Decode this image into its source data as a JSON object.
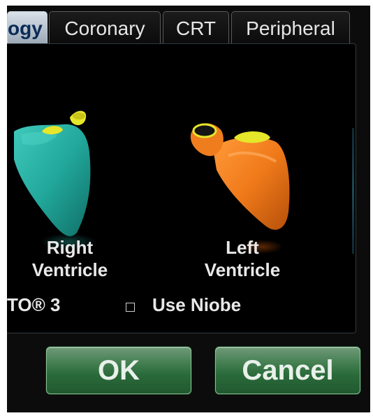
{
  "tabs": [
    {
      "label": "ogy",
      "active": true
    },
    {
      "label": "Coronary",
      "active": false
    },
    {
      "label": "CRT",
      "active": false
    },
    {
      "label": "Peripheral",
      "active": false
    }
  ],
  "selection": {
    "right_ventricle": {
      "line1": "Right",
      "line2": "Ventricle",
      "color": "#22a89c"
    },
    "left_ventricle": {
      "line1": "Left",
      "line2": "Ventricle",
      "color": "#f07a1a"
    },
    "valve_color": "#e6e62a"
  },
  "options": {
    "partial_option": "TO® 3",
    "use_niobe": {
      "label": "Use Niobe",
      "checked": false
    }
  },
  "buttons": {
    "ok": "OK",
    "cancel": "Cancel"
  }
}
